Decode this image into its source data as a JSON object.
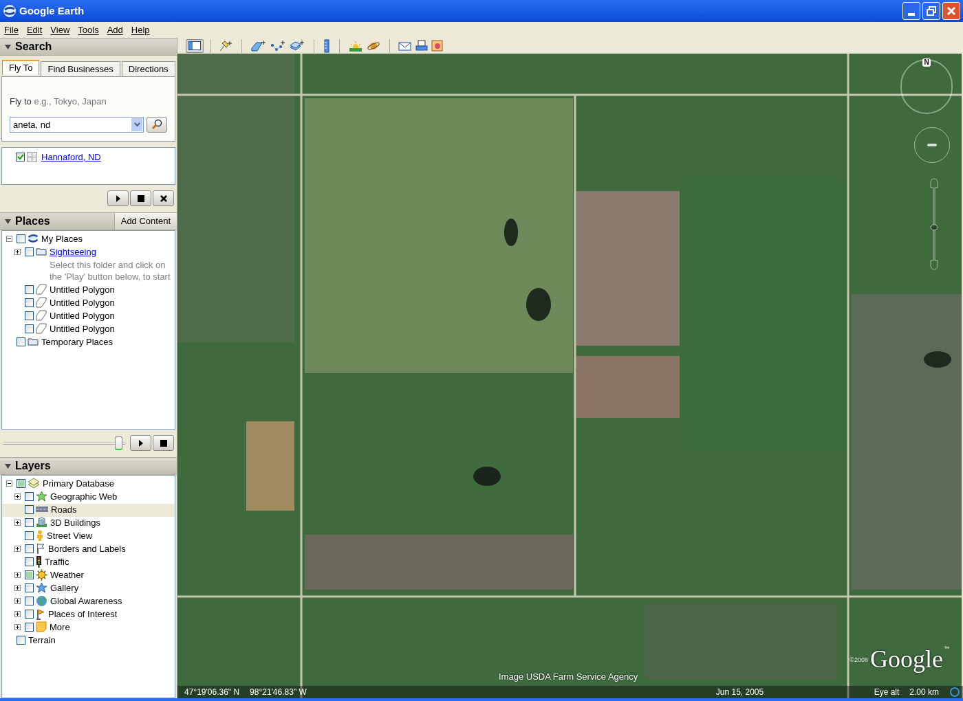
{
  "window": {
    "title": "Google Earth"
  },
  "menu": [
    "File",
    "Edit",
    "View",
    "Tools",
    "Add",
    "Help"
  ],
  "search": {
    "title": "Search",
    "expanded": true,
    "tabs": [
      {
        "label": "Fly To",
        "selected": true
      },
      {
        "label": "Find Businesses",
        "selected": false
      },
      {
        "label": "Directions",
        "selected": false
      }
    ],
    "hint_label": "Fly to",
    "hint_example": "e.g., Tokyo, Japan",
    "value": "aneta, nd",
    "results": [
      {
        "label": "Hannaford, ND",
        "checked": true
      }
    ]
  },
  "places": {
    "title": "Places",
    "expanded": true,
    "add_button": "Add Content",
    "slider": {
      "level": 0.97
    },
    "tree": [
      {
        "kind": "earth",
        "label": "My Places",
        "checked": false,
        "expanded": true,
        "children": [
          {
            "kind": "folder",
            "label": "Sightseeing",
            "link": true,
            "checked": false,
            "expanded": false,
            "description": "Select this folder and click on the 'Play' button below, to start"
          },
          {
            "kind": "polygon",
            "label": "Untitled Polygon",
            "checked": false
          },
          {
            "kind": "polygon",
            "label": "Untitled Polygon",
            "checked": false
          },
          {
            "kind": "polygon",
            "label": "Untitled Polygon",
            "checked": false
          },
          {
            "kind": "polygon",
            "label": "Untitled Polygon",
            "checked": false
          }
        ]
      },
      {
        "kind": "folder",
        "label": "Temporary Places",
        "checked": false
      }
    ]
  },
  "layers": {
    "title": "Layers",
    "expanded": true,
    "tree": [
      {
        "kind": "database",
        "label": "Primary Database",
        "checked": false,
        "partial": true,
        "expanded": true,
        "selected": false,
        "children": [
          {
            "kind": "star",
            "label": "Geographic Web",
            "checked": false,
            "expanded": false,
            "selected": false
          },
          {
            "kind": "road",
            "label": "Roads",
            "checked": false,
            "selected": true
          },
          {
            "kind": "building",
            "label": "3D Buildings",
            "checked": false,
            "expanded": false,
            "selected": false
          },
          {
            "kind": "person",
            "label": "Street View",
            "checked": false,
            "selected": false
          },
          {
            "kind": "flag",
            "label": "Borders and Labels",
            "checked": false,
            "expanded": false,
            "selected": false
          },
          {
            "kind": "traffic",
            "label": "Traffic",
            "checked": false,
            "selected": false
          },
          {
            "kind": "sun",
            "label": "Weather",
            "checked": false,
            "partial": true,
            "expanded": false,
            "selected": false
          },
          {
            "kind": "bluestar",
            "label": "Gallery",
            "checked": false,
            "expanded": false,
            "selected": false
          },
          {
            "kind": "globe",
            "label": "Global Awareness",
            "checked": false,
            "expanded": false,
            "selected": false
          },
          {
            "kind": "pennant",
            "label": "Places of Interest",
            "checked": false,
            "expanded": false,
            "selected": false
          },
          {
            "kind": "note",
            "label": "More",
            "checked": false,
            "expanded": false,
            "selected": false
          }
        ]
      },
      {
        "kind": "plain",
        "label": "Terrain",
        "checked": false,
        "selected": false
      }
    ]
  },
  "map": {
    "compass": "N",
    "zoom_slider": {
      "level": 0.45
    },
    "attribution": "Image USDA Farm Service Agency",
    "copyright": "©2008",
    "logo": "Google",
    "trademark": "™",
    "status": {
      "latitude": "47°19'06.36\" N",
      "longitude": "98°21'46.83\" W",
      "date": "Jun 15, 2005",
      "eye_alt_label": "Eye alt",
      "eye_alt": "2.00 km"
    }
  }
}
